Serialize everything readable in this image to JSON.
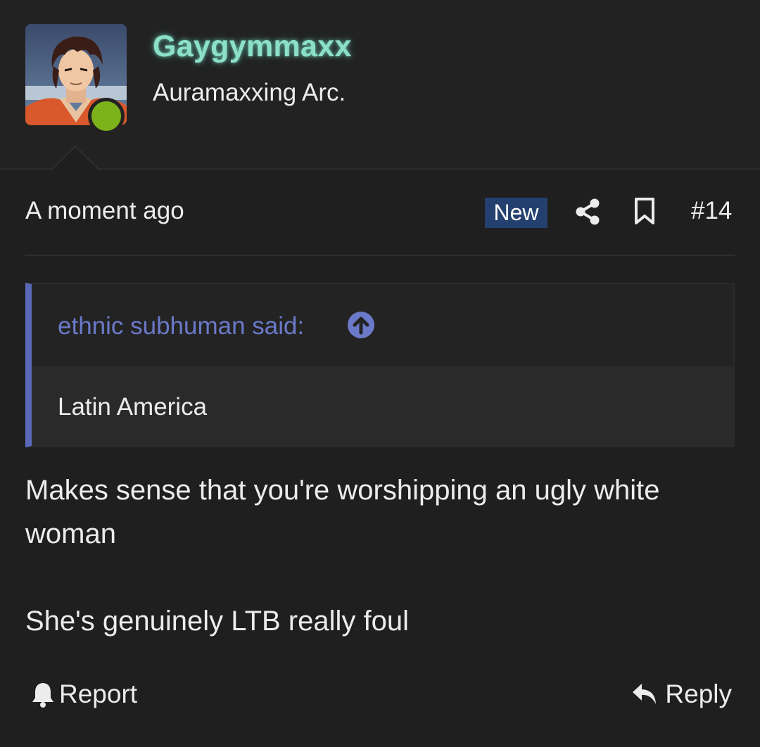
{
  "user": {
    "name": "Gaygymmaxx",
    "title": "Auramaxxing Arc.",
    "online": true,
    "avatar_icon": "anime-character-avatar"
  },
  "post": {
    "date": "A moment ago",
    "badge": "New",
    "number": "#14"
  },
  "quote": {
    "author": "ethnic subhuman said:",
    "text": "Latin America"
  },
  "message": {
    "paragraphs": [
      "Makes sense that you're worshipping an ugly white woman",
      "She's genuinely LTB really foul"
    ]
  },
  "actions": {
    "report_label": "Report",
    "reply_label": "Reply"
  },
  "colors": {
    "background": "#1f1f1f",
    "username": "#8ce0c8",
    "badge": "#23406f",
    "quote_accent": "#5a68b8",
    "online": "#7db31a"
  }
}
